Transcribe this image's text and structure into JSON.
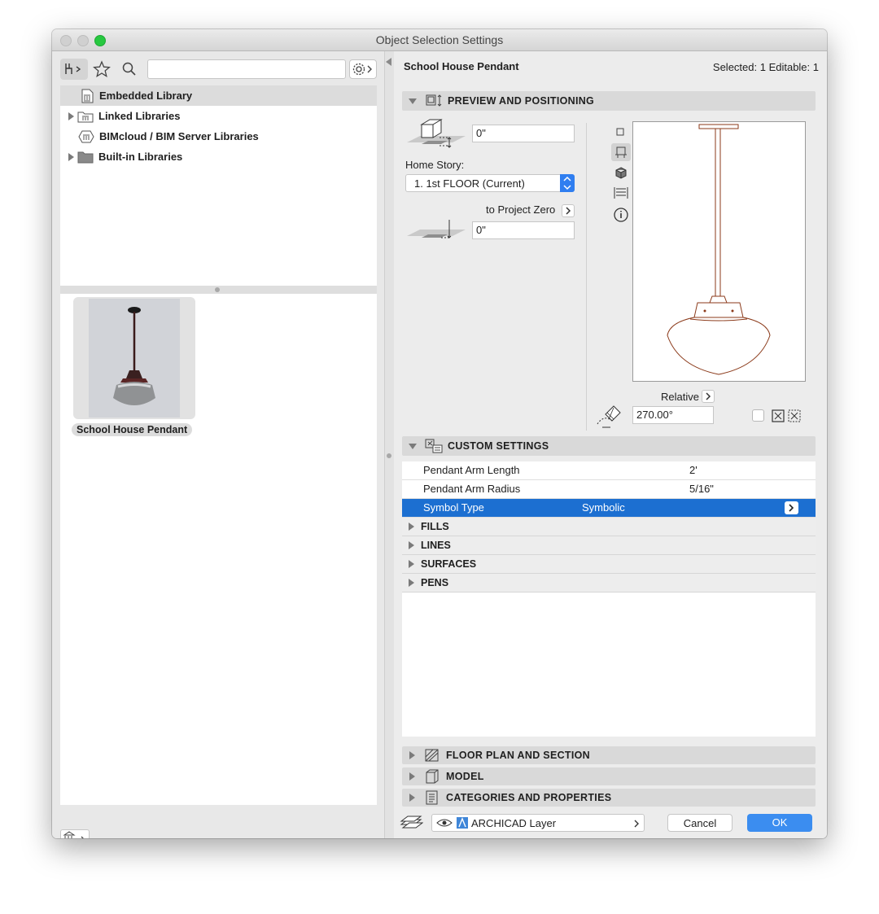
{
  "window": {
    "title": "Object Selection Settings"
  },
  "library": {
    "search_placeholder": "",
    "tree": [
      {
        "label": "Embedded Library",
        "expandable": false,
        "selected": true
      },
      {
        "label": "Linked Libraries",
        "expandable": true,
        "selected": false
      },
      {
        "label": "BIMcloud / BIM Server Libraries",
        "expandable": false,
        "selected": false
      },
      {
        "label": "Built-in Libraries",
        "expandable": true,
        "selected": false
      }
    ],
    "selected_item": {
      "label": "School House Pendant"
    }
  },
  "header": {
    "object_name": "School House Pendant",
    "selection_info": "Selected: 1 Editable: 1"
  },
  "preview_positioning": {
    "title": "PREVIEW AND POSITIONING",
    "elevation_value": "0\"",
    "home_story_label": "Home Story:",
    "home_story_value": "1. 1st FLOOR (Current)",
    "to_project_zero_label": "to Project Zero",
    "project_zero_value": "0\"",
    "relative_label": "Relative",
    "angle_value": "270.00°"
  },
  "custom_settings": {
    "title": "CUSTOM SETTINGS",
    "params": [
      {
        "name": "Pendant Arm Length",
        "value": "2'"
      },
      {
        "name": "Pendant Arm Radius",
        "value": "5/16\""
      },
      {
        "name": "Symbol Type",
        "value": "Symbolic"
      }
    ],
    "groups": [
      "FILLS",
      "LINES",
      "SURFACES",
      "PENS"
    ]
  },
  "panels": [
    "FLOOR PLAN AND SECTION",
    "MODEL",
    "CATEGORIES AND PROPERTIES"
  ],
  "footer": {
    "layer": "ARCHICAD Layer",
    "cancel_label": "Cancel",
    "ok_label": "OK"
  },
  "colors": {
    "accent": "#1c6fd1",
    "ok_button": "#3b8df0",
    "close": "#d0d0d0",
    "zoom": "#27c840",
    "lamp_outline": "#8b3a1a"
  }
}
